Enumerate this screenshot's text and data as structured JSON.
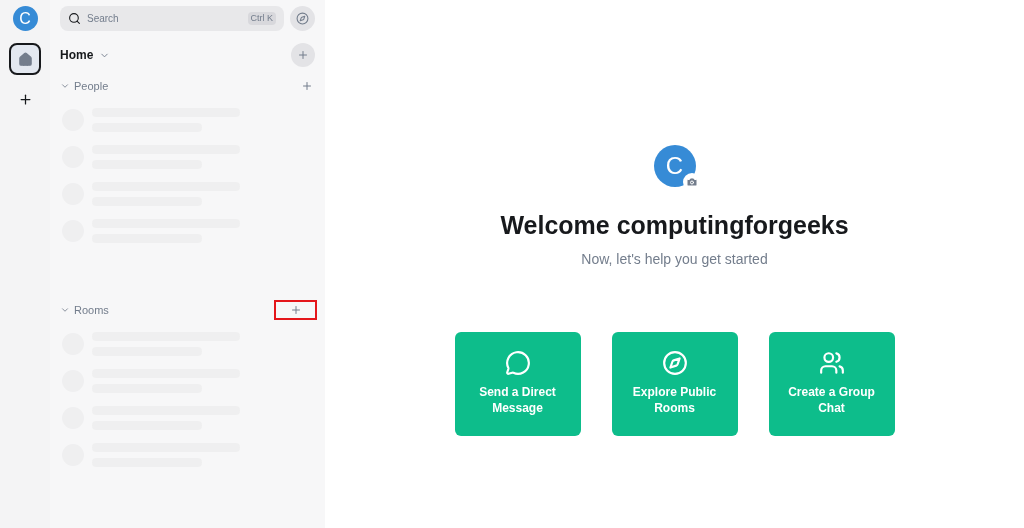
{
  "rail": {
    "avatar": "C",
    "items": [
      {
        "kind": "home",
        "selected": true
      }
    ]
  },
  "search": {
    "placeholder": "Search",
    "shortcut": "Ctrl K"
  },
  "home": {
    "title": "Home"
  },
  "sections": [
    {
      "title": "People",
      "expanded": true,
      "highlighted": false
    },
    {
      "title": "Rooms",
      "expanded": true,
      "highlighted": true
    }
  ],
  "welcome": {
    "avatar": "C",
    "title": "Welcome computingforgeeks",
    "subtitle": "Now, let's help you get started",
    "cards": [
      {
        "kind": "message",
        "label": "Send a Direct Message"
      },
      {
        "kind": "explore",
        "label": "Explore Public Rooms"
      },
      {
        "kind": "group",
        "label": "Create a Group Chat"
      }
    ]
  }
}
